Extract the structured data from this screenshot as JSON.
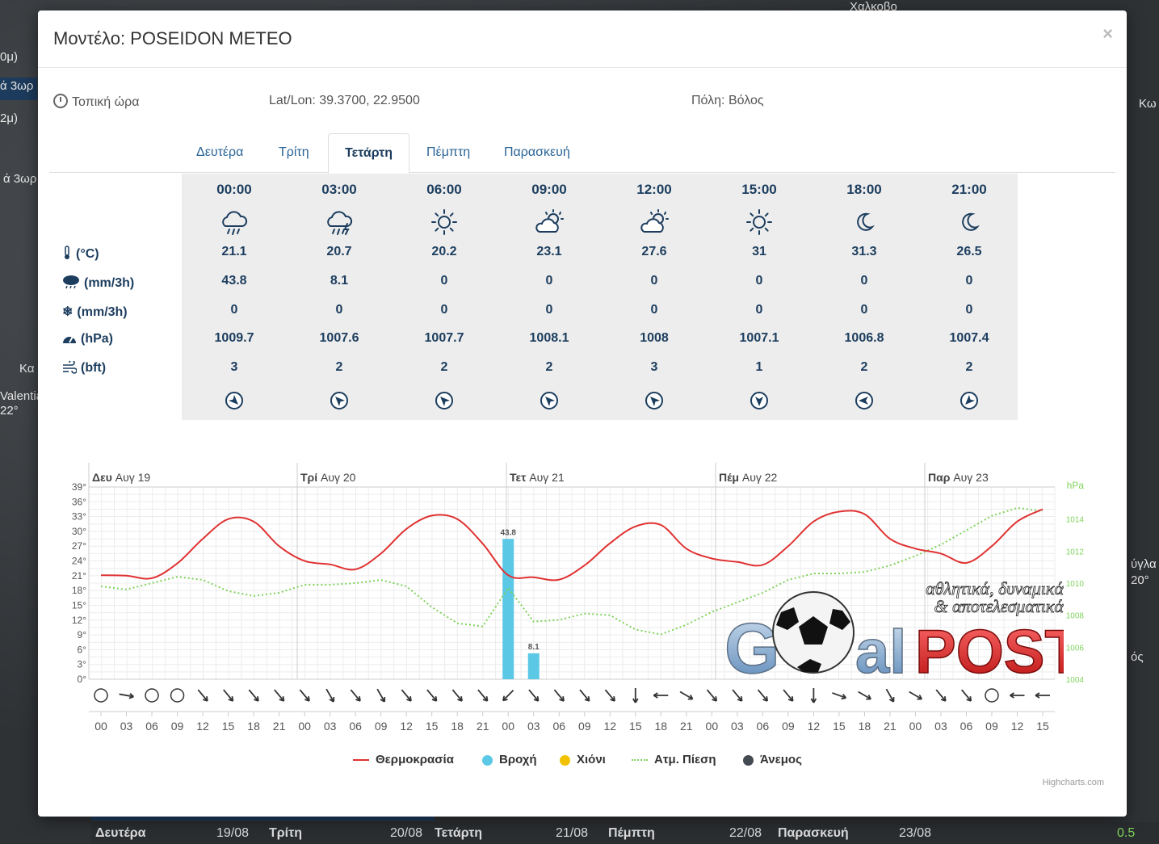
{
  "modal": {
    "title": "Μοντέλο: POSEIDON METEO",
    "close": "×",
    "local_time": "Τοπική ώρα",
    "latlon": "Lat/Lon: 39.3700, 22.9500",
    "city": "Πόλη: Βόλος"
  },
  "tabs": [
    "Δευτέρα",
    "Τρίτη",
    "Τετάρτη",
    "Πέμπτη",
    "Παρασκευή"
  ],
  "active_tab": "Τετάρτη",
  "row_labels": [
    "(°C)",
    "(mm/3h)",
    "(mm/3h)",
    "(hPa)",
    "(bft)"
  ],
  "forecast": [
    {
      "time": "00:00",
      "icon": "rain-cloud-icon",
      "temp": "21.1",
      "rain": "43.8",
      "snow": "0",
      "pressure": "1009.7",
      "wind": "3",
      "dir": 135
    },
    {
      "time": "03:00",
      "icon": "thunderstorm-cloud-icon",
      "temp": "20.7",
      "rain": "8.1",
      "snow": "0",
      "pressure": "1007.6",
      "wind": "2",
      "dir": -45
    },
    {
      "time": "06:00",
      "icon": "sun-icon",
      "temp": "20.2",
      "rain": "0",
      "snow": "0",
      "pressure": "1007.7",
      "wind": "2",
      "dir": -45
    },
    {
      "time": "09:00",
      "icon": "sun-cloud-icon",
      "temp": "23.1",
      "rain": "0",
      "snow": "0",
      "pressure": "1008.1",
      "wind": "2",
      "dir": -45
    },
    {
      "time": "12:00",
      "icon": "sun-cloud-icon",
      "temp": "27.6",
      "rain": "0",
      "snow": "0",
      "pressure": "1008",
      "wind": "3",
      "dir": -45
    },
    {
      "time": "15:00",
      "icon": "sun-icon",
      "temp": "31",
      "rain": "0",
      "snow": "0",
      "pressure": "1007.1",
      "wind": "1",
      "dir": 180
    },
    {
      "time": "18:00",
      "icon": "moon-icon",
      "temp": "31.3",
      "rain": "0",
      "snow": "0",
      "pressure": "1006.8",
      "wind": "2",
      "dir": -90
    },
    {
      "time": "21:00",
      "icon": "moon-icon",
      "temp": "26.5",
      "rain": "0",
      "snow": "0",
      "pressure": "1007.4",
      "wind": "2",
      "dir": -135
    }
  ],
  "chart_data": {
    "type": "line",
    "day_labels": [
      {
        "bold": "Δευ",
        "rest": "Αυγ 19"
      },
      {
        "bold": "Τρί",
        "rest": "Αυγ 20"
      },
      {
        "bold": "Τετ",
        "rest": "Αυγ 21"
      },
      {
        "bold": "Πέμ",
        "rest": "Αυγ 22"
      },
      {
        "bold": "Παρ",
        "rest": "Αυγ 23"
      }
    ],
    "x_ticks": [
      "00",
      "03",
      "06",
      "09",
      "12",
      "15",
      "18",
      "21",
      "00",
      "03",
      "06",
      "09",
      "12",
      "15",
      "18",
      "21",
      "00",
      "03",
      "06",
      "09",
      "12",
      "15",
      "18",
      "21",
      "00",
      "03",
      "06",
      "09",
      "12",
      "15",
      "18",
      "21",
      "00",
      "03",
      "06",
      "09",
      "12",
      "15"
    ],
    "y_left_ticks": [
      "0°",
      "3°",
      "6°",
      "9°",
      "12°",
      "15°",
      "18°",
      "21°",
      "24°",
      "27°",
      "30°",
      "33°",
      "36°",
      "39°"
    ],
    "y_left_range": [
      0,
      39
    ],
    "y_right_ticks": [
      "1004",
      "1006",
      "1008",
      "1010",
      "1012",
      "1014"
    ],
    "y_right_label": "hPa",
    "y_right_range": [
      1004,
      1016
    ],
    "temperature": [
      21.1,
      21,
      20.5,
      23.5,
      28.5,
      32.5,
      32,
      27,
      24,
      23.3,
      22.3,
      25.5,
      30.5,
      33.2,
      32.5,
      27.5,
      21.1,
      20.7,
      20.2,
      23.1,
      27.6,
      31,
      31.3,
      26.5,
      24.5,
      23.8,
      23.2,
      27,
      32,
      34,
      33.5,
      28.5,
      26.5,
      25.5,
      23.6,
      27,
      32,
      34.5
    ],
    "pressure": [
      1009.8,
      1009.6,
      1010,
      1010.4,
      1010.2,
      1009.5,
      1009.2,
      1009.4,
      1009.9,
      1009.9,
      1010,
      1010.2,
      1009.8,
      1008.5,
      1007.5,
      1007.3,
      1009.7,
      1007.6,
      1007.7,
      1008.1,
      1008,
      1007.1,
      1006.8,
      1007.4,
      1008.2,
      1008.8,
      1009.4,
      1010.2,
      1010.6,
      1010.6,
      1010.7,
      1011.1,
      1011.7,
      1012.4,
      1013.3,
      1014.2,
      1014.7,
      1014.5
    ],
    "rain": [
      {
        "index": 16,
        "value": 43.8,
        "label": "43.8"
      },
      {
        "index": 17,
        "value": 8.1,
        "label": "8.1"
      }
    ],
    "rain_scale_max": 60,
    "wind_dirs": [
      "calm",
      -80,
      "calm",
      "calm",
      -40,
      -40,
      -40,
      -40,
      -40,
      -30,
      -40,
      -30,
      -40,
      -40,
      -40,
      -40,
      45,
      -40,
      -40,
      -40,
      -40,
      0,
      90,
      -60,
      -40,
      -40,
      -40,
      -40,
      0,
      -70,
      -60,
      -30,
      -60,
      -40,
      -40,
      "calm",
      90,
      90
    ],
    "legend": [
      "Θερμοκρασία",
      "Βροχή",
      "Χιόνι",
      "Ατμ. Πίεση",
      "Άνεμος"
    ],
    "credits": "Highcharts.com",
    "colors": {
      "temperature": "#e03232",
      "rain": "#5bc8e6",
      "snow": "#f2c200",
      "pressure": "#7fd35b",
      "wind": "#444a52"
    }
  },
  "background": {
    "labels": [
      "0μ)",
      "ά 3ωρ",
      "2μ)",
      "ά 3ωρ",
      "Κα",
      "Valentia",
      "22°",
      "Χαλκοβο",
      "Κω",
      "ύγλα",
      "20°",
      "ός"
    ],
    "bottom_days": [
      {
        "day": "Δευτέρα",
        "date": "19/08"
      },
      {
        "day": "Τρίτη",
        "date": "20/08"
      },
      {
        "day": "Τετάρτη",
        "date": "21/08"
      },
      {
        "day": "Πέμπτη",
        "date": "22/08"
      },
      {
        "day": "Παρασκευή",
        "date": "23/08"
      }
    ],
    "legend_value": "0.5"
  },
  "watermark": {
    "line1": "αθλητικά, δυναμικά",
    "line2": "& αποτελεσματικά",
    "brand_a": "G",
    "brand_b": "al",
    "brand_c": "POST"
  }
}
